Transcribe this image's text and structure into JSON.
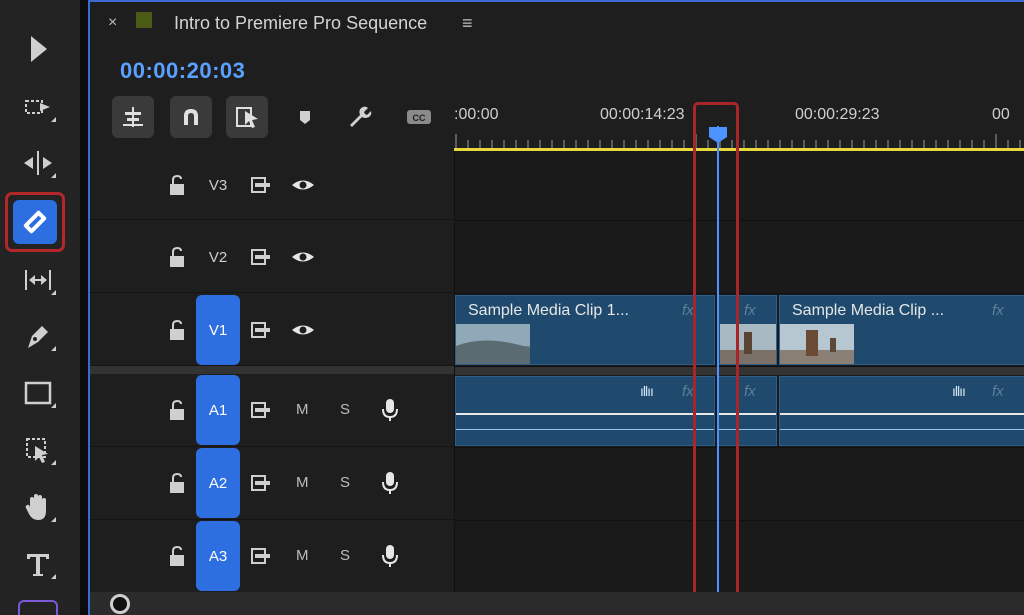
{
  "sequence": {
    "title": "Intro to Premiere Pro Sequence",
    "close_glyph": "×",
    "menu_glyph": "≡",
    "timecode": "00:00:20:03"
  },
  "tools": [
    {
      "name": "selection-tool",
      "icon": "arrow-icon"
    },
    {
      "name": "track-select-forward-tool",
      "icon": "track-select-icon"
    },
    {
      "name": "ripple-edit-tool",
      "icon": "ripple-edit-icon"
    },
    {
      "name": "razor-tool",
      "icon": "razor-icon",
      "active": true
    },
    {
      "name": "slip-tool",
      "icon": "slip-icon"
    },
    {
      "name": "pen-tool",
      "icon": "pen-icon"
    },
    {
      "name": "rectangle-tool",
      "icon": "rectangle-icon"
    },
    {
      "name": "object-select-tool",
      "icon": "object-select-icon"
    },
    {
      "name": "hand-tool",
      "icon": "hand-icon"
    },
    {
      "name": "type-tool",
      "icon": "type-icon"
    }
  ],
  "ruler": {
    "labels": [
      ":00:00",
      "00:00:14:23",
      "00:00:29:23",
      "00"
    ]
  },
  "video_tracks": [
    {
      "label": "V3",
      "targeted": false
    },
    {
      "label": "V2",
      "targeted": false
    },
    {
      "label": "V1",
      "targeted": true
    }
  ],
  "audio_tracks": [
    {
      "label": "A1",
      "m": "M",
      "s": "S"
    },
    {
      "label": "A2",
      "m": "M",
      "s": "S"
    },
    {
      "label": "A3",
      "m": "M",
      "s": "S"
    }
  ],
  "clips": {
    "v1_clip1": "Sample Media Clip 1...",
    "v1_clip3": "Sample Media Clip ...",
    "fx": "fx"
  },
  "colors": {
    "accent": "#2d6fe0",
    "timecode": "#5aa0ff",
    "clip": "#1f4a6e",
    "work_area": "#e8d83a",
    "highlight": "#a8262a"
  }
}
